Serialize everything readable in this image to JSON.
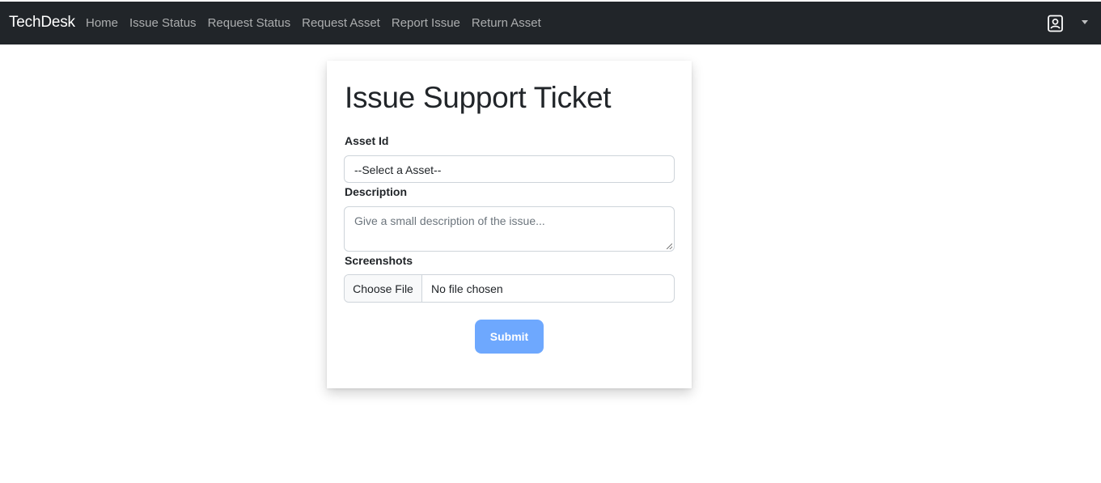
{
  "navbar": {
    "brand": "TechDesk",
    "links": [
      {
        "label": "Home"
      },
      {
        "label": "Issue Status"
      },
      {
        "label": "Request Status"
      },
      {
        "label": "Request Asset"
      },
      {
        "label": "Report Issue"
      },
      {
        "label": "Return Asset"
      }
    ],
    "user_icon": "user-badge-icon",
    "dropdown_icon": "caret-down-icon"
  },
  "form": {
    "title": "Issue Support Ticket",
    "asset": {
      "label": "Asset Id",
      "selected": "--Select a Asset--"
    },
    "description": {
      "label": "Description",
      "placeholder": "Give a small description of the issue..."
    },
    "screenshots": {
      "label": "Screenshots",
      "button_label": "Choose File",
      "status": "No file chosen"
    },
    "submit_label": "Submit"
  },
  "colors": {
    "navbar_bg": "#212529",
    "submit_bg": "#6ea8fe",
    "border": "#ced4da"
  }
}
